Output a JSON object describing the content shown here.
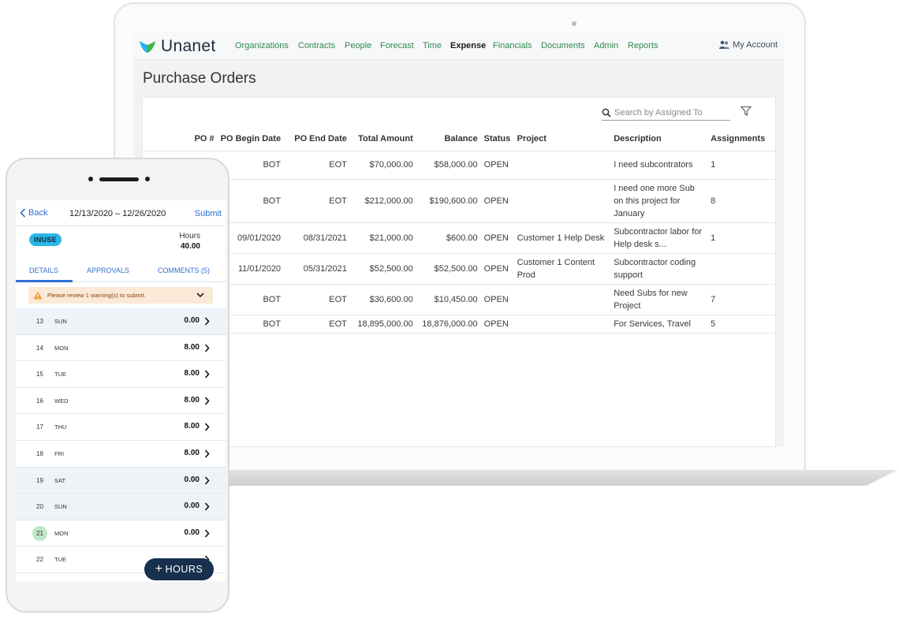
{
  "app": {
    "brand": "Unanet",
    "nav": [
      "Organizations",
      "Contracts",
      "People",
      "Forecast",
      "Time",
      "Expense",
      "Financials",
      "Documents",
      "Admin",
      "Reports"
    ],
    "active_nav": "Expense",
    "account_label": "My Account",
    "page_title": "Purchase Orders",
    "search_placeholder": "Search by Assigned To",
    "columns": [
      "PO #",
      "PO Begin Date",
      "PO End Date",
      "Total Amount",
      "Balance",
      "Status",
      "Project",
      "Description",
      "Assignments"
    ],
    "rows": [
      {
        "po": "",
        "begin": "BOT",
        "end": "EOT",
        "total": "$70,000.00",
        "balance": "$58,000.00",
        "status": "OPEN",
        "project": "",
        "description": "I need subcontrators",
        "assignments": "1"
      },
      {
        "po": "",
        "begin": "BOT",
        "end": "EOT",
        "total": "$212,000.00",
        "balance": "$190,600.00",
        "status": "OPEN",
        "project": "",
        "description": "I need one more Sub on this project for January",
        "assignments": "8"
      },
      {
        "po": "",
        "begin": "09/01/2020",
        "end": "08/31/2021",
        "total": "$21,000.00",
        "balance": "$600.00",
        "status": "OPEN",
        "project": "Customer 1 Help Desk",
        "description": "Subcontractor labor for Help desk s...",
        "assignments": "1"
      },
      {
        "po": "",
        "begin": "11/01/2020",
        "end": "05/31/2021",
        "total": "$52,500.00",
        "balance": "$52,500.00",
        "status": "OPEN",
        "project": "Customer 1 Content Prod",
        "description": "Subcontractor coding support",
        "assignments": ""
      },
      {
        "po": "",
        "begin": "BOT",
        "end": "EOT",
        "total": "$30,600.00",
        "balance": "$10,450.00",
        "status": "OPEN",
        "project": "",
        "description": "Need Subs for new Project",
        "assignments": "7"
      },
      {
        "po": "",
        "begin": "BOT",
        "end": "EOT",
        "total": "18,895,000.00",
        "balance": "18,876,000.00",
        "status": "OPEN",
        "project": "",
        "description": "For Services, Travel",
        "assignments": "5"
      }
    ]
  },
  "mobile": {
    "back_label": "Back",
    "date_range": "12/13/2020 – 12/26/2020",
    "submit_label": "Submit",
    "status_badge": "INUSE",
    "hours_label": "Hours",
    "hours_total": "40.00",
    "tabs": [
      "DETAILS",
      "APPROVALS",
      "COMMENTS (5)"
    ],
    "active_tab": "DETAILS",
    "warning": "Please review 1 warning(s) to submit.",
    "days": [
      {
        "num": "13",
        "name": "SUN",
        "hours": "0.00",
        "shaded": true,
        "today": false
      },
      {
        "num": "14",
        "name": "MON",
        "hours": "8.00",
        "shaded": false,
        "today": false
      },
      {
        "num": "15",
        "name": "TUE",
        "hours": "8.00",
        "shaded": false,
        "today": false
      },
      {
        "num": "16",
        "name": "WED",
        "hours": "8.00",
        "shaded": false,
        "today": false
      },
      {
        "num": "17",
        "name": "THU",
        "hours": "8.00",
        "shaded": false,
        "today": false
      },
      {
        "num": "18",
        "name": "FRI",
        "hours": "8.00",
        "shaded": false,
        "today": false
      },
      {
        "num": "19",
        "name": "SAT",
        "hours": "0.00",
        "shaded": true,
        "today": false
      },
      {
        "num": "20",
        "name": "SUN",
        "hours": "0.00",
        "shaded": true,
        "today": false
      },
      {
        "num": "21",
        "name": "MON",
        "hours": "0.00",
        "shaded": false,
        "today": true
      },
      {
        "num": "22",
        "name": "TUE",
        "hours": "",
        "shaded": false,
        "today": false
      }
    ],
    "fab_label": "HOURS"
  },
  "colors": {
    "nav_link": "#2e8a4e",
    "mobile_accent": "#2f6fd1",
    "badge": "#2bb6e8",
    "fab": "#16304d",
    "today_circle": "#bfe6c8"
  }
}
